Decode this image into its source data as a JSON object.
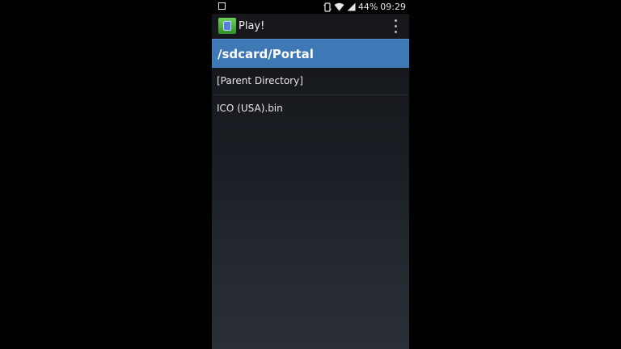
{
  "status_bar": {
    "battery": "44%",
    "time": "09:29"
  },
  "action_bar": {
    "title": "Play!",
    "icons": [
      "app-icon",
      "overflow-menu-icon"
    ]
  },
  "browser": {
    "path": "/sdcard/Portal",
    "items": [
      {
        "label": "[Parent Directory]"
      },
      {
        "label": "ICO (USA).bin"
      }
    ]
  },
  "colors": {
    "accent": "#3e78b5",
    "action_bar_line": "#4f8fc8"
  }
}
